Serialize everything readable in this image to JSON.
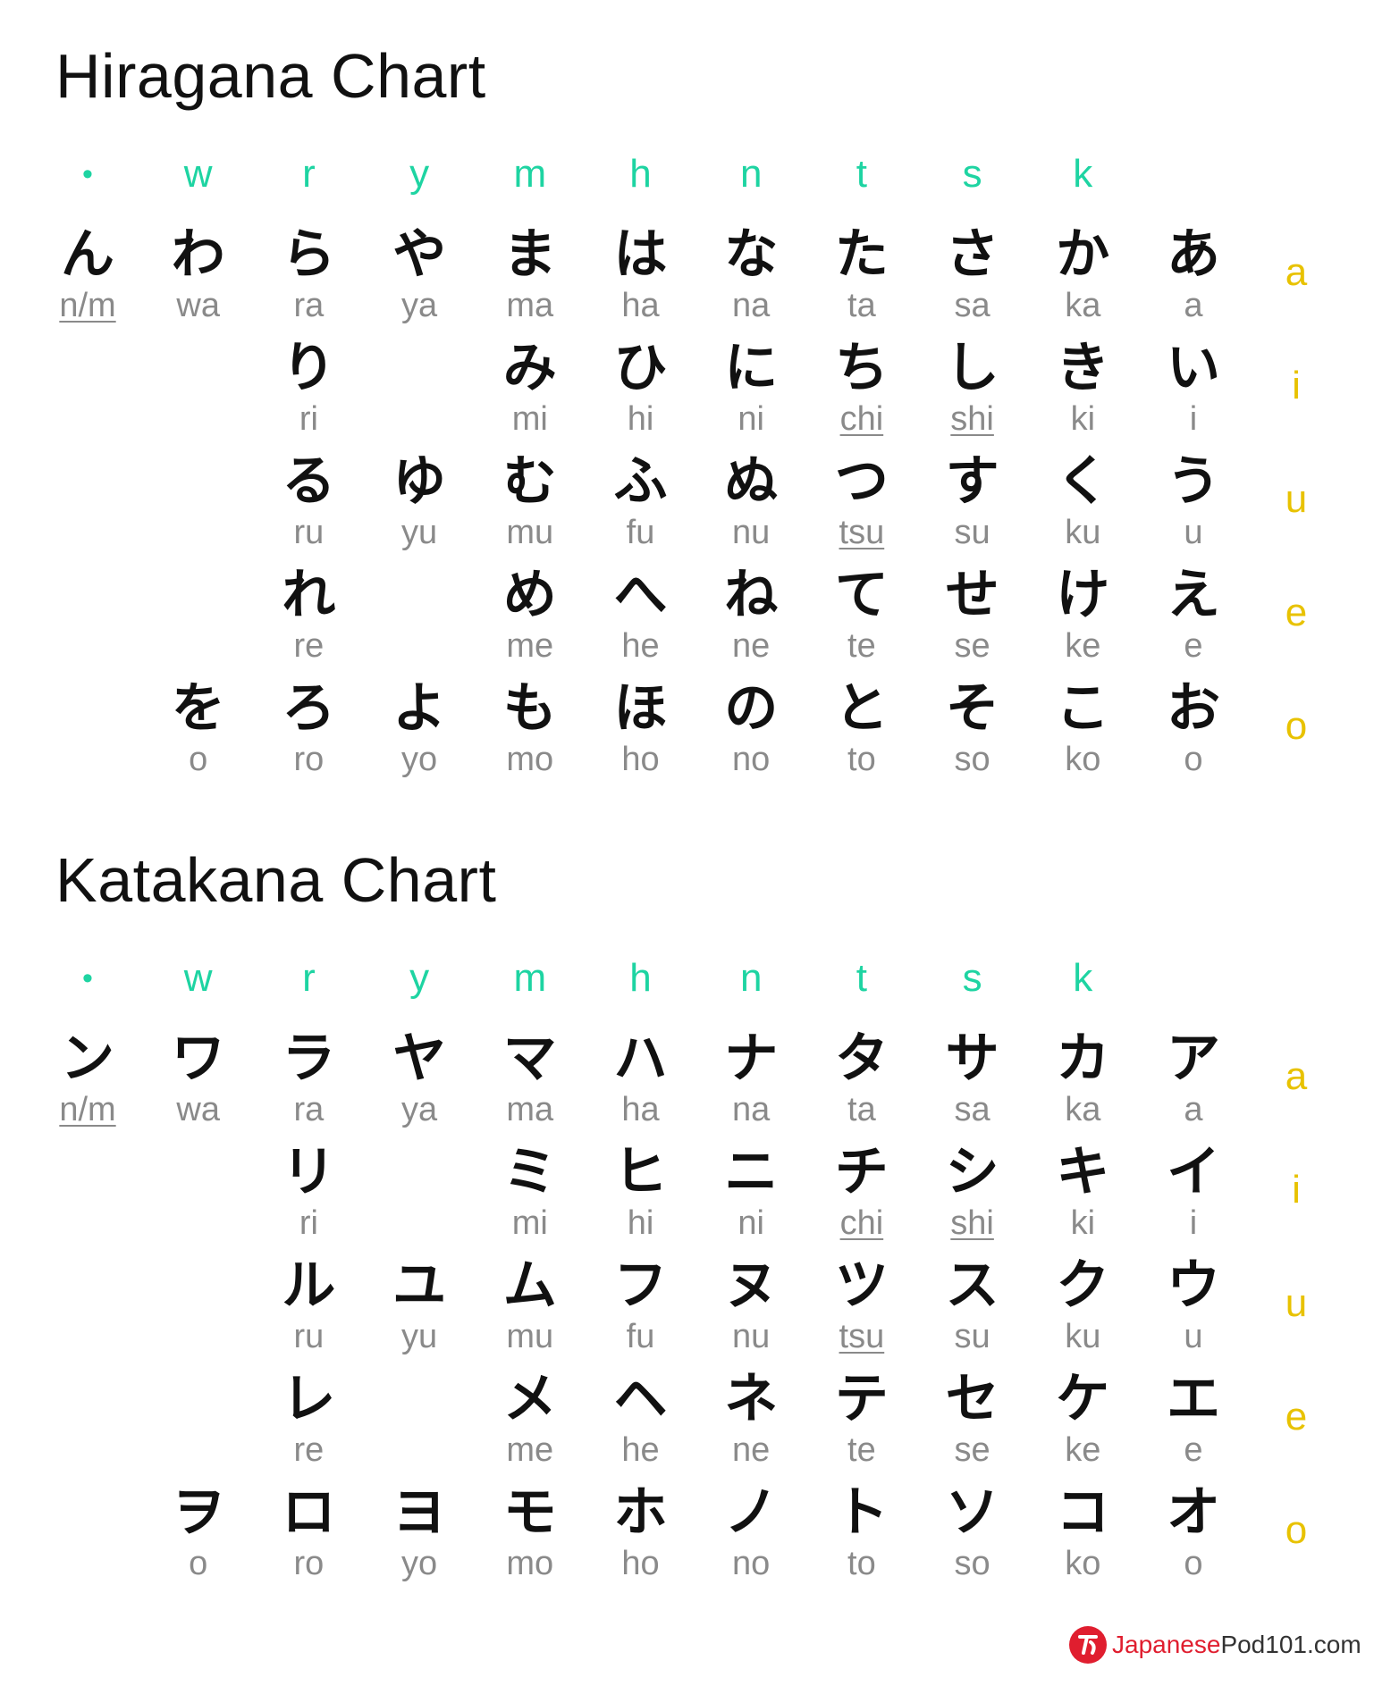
{
  "consonants": [
    "•",
    "w",
    "r",
    "y",
    "m",
    "h",
    "n",
    "t",
    "s",
    "k"
  ],
  "vowels": [
    "a",
    "i",
    "u",
    "e",
    "o"
  ],
  "hiragana": {
    "title": "Hiragana Chart",
    "cells": [
      {
        "col": 0,
        "row": 0,
        "kana": "ん",
        "romaji": "n/m",
        "underline": true
      },
      {
        "col": 1,
        "row": 0,
        "kana": "わ",
        "romaji": "wa"
      },
      {
        "col": 2,
        "row": 0,
        "kana": "ら",
        "romaji": "ra"
      },
      {
        "col": 3,
        "row": 0,
        "kana": "や",
        "romaji": "ya"
      },
      {
        "col": 4,
        "row": 0,
        "kana": "ま",
        "romaji": "ma"
      },
      {
        "col": 5,
        "row": 0,
        "kana": "は",
        "romaji": "ha"
      },
      {
        "col": 6,
        "row": 0,
        "kana": "な",
        "romaji": "na"
      },
      {
        "col": 7,
        "row": 0,
        "kana": "た",
        "romaji": "ta"
      },
      {
        "col": 8,
        "row": 0,
        "kana": "さ",
        "romaji": "sa"
      },
      {
        "col": 9,
        "row": 0,
        "kana": "か",
        "romaji": "ka"
      },
      {
        "col": 10,
        "row": 0,
        "kana": "あ",
        "romaji": "a"
      },
      {
        "col": 2,
        "row": 1,
        "kana": "り",
        "romaji": "ri"
      },
      {
        "col": 4,
        "row": 1,
        "kana": "み",
        "romaji": "mi"
      },
      {
        "col": 5,
        "row": 1,
        "kana": "ひ",
        "romaji": "hi"
      },
      {
        "col": 6,
        "row": 1,
        "kana": "に",
        "romaji": "ni"
      },
      {
        "col": 7,
        "row": 1,
        "kana": "ち",
        "romaji": "chi",
        "underline": true
      },
      {
        "col": 8,
        "row": 1,
        "kana": "し",
        "romaji": "shi",
        "underline": true
      },
      {
        "col": 9,
        "row": 1,
        "kana": "き",
        "romaji": "ki"
      },
      {
        "col": 10,
        "row": 1,
        "kana": "い",
        "romaji": "i"
      },
      {
        "col": 2,
        "row": 2,
        "kana": "る",
        "romaji": "ru"
      },
      {
        "col": 3,
        "row": 2,
        "kana": "ゆ",
        "romaji": "yu"
      },
      {
        "col": 4,
        "row": 2,
        "kana": "む",
        "romaji": "mu"
      },
      {
        "col": 5,
        "row": 2,
        "kana": "ふ",
        "romaji": "fu"
      },
      {
        "col": 6,
        "row": 2,
        "kana": "ぬ",
        "romaji": "nu"
      },
      {
        "col": 7,
        "row": 2,
        "kana": "つ",
        "romaji": "tsu",
        "underline": true
      },
      {
        "col": 8,
        "row": 2,
        "kana": "す",
        "romaji": "su"
      },
      {
        "col": 9,
        "row": 2,
        "kana": "く",
        "romaji": "ku"
      },
      {
        "col": 10,
        "row": 2,
        "kana": "う",
        "romaji": "u"
      },
      {
        "col": 2,
        "row": 3,
        "kana": "れ",
        "romaji": "re"
      },
      {
        "col": 4,
        "row": 3,
        "kana": "め",
        "romaji": "me"
      },
      {
        "col": 5,
        "row": 3,
        "kana": "へ",
        "romaji": "he"
      },
      {
        "col": 6,
        "row": 3,
        "kana": "ね",
        "romaji": "ne"
      },
      {
        "col": 7,
        "row": 3,
        "kana": "て",
        "romaji": "te"
      },
      {
        "col": 8,
        "row": 3,
        "kana": "せ",
        "romaji": "se"
      },
      {
        "col": 9,
        "row": 3,
        "kana": "け",
        "romaji": "ke"
      },
      {
        "col": 10,
        "row": 3,
        "kana": "え",
        "romaji": "e"
      },
      {
        "col": 1,
        "row": 4,
        "kana": "を",
        "romaji": "o"
      },
      {
        "col": 2,
        "row": 4,
        "kana": "ろ",
        "romaji": "ro"
      },
      {
        "col": 3,
        "row": 4,
        "kana": "よ",
        "romaji": "yo"
      },
      {
        "col": 4,
        "row": 4,
        "kana": "も",
        "romaji": "mo"
      },
      {
        "col": 5,
        "row": 4,
        "kana": "ほ",
        "romaji": "ho"
      },
      {
        "col": 6,
        "row": 4,
        "kana": "の",
        "romaji": "no"
      },
      {
        "col": 7,
        "row": 4,
        "kana": "と",
        "romaji": "to"
      },
      {
        "col": 8,
        "row": 4,
        "kana": "そ",
        "romaji": "so"
      },
      {
        "col": 9,
        "row": 4,
        "kana": "こ",
        "romaji": "ko"
      },
      {
        "col": 10,
        "row": 4,
        "kana": "お",
        "romaji": "o"
      }
    ]
  },
  "katakana": {
    "title": "Katakana Chart",
    "cells": [
      {
        "col": 0,
        "row": 0,
        "kana": "ン",
        "romaji": "n/m",
        "underline": true
      },
      {
        "col": 1,
        "row": 0,
        "kana": "ワ",
        "romaji": "wa"
      },
      {
        "col": 2,
        "row": 0,
        "kana": "ラ",
        "romaji": "ra"
      },
      {
        "col": 3,
        "row": 0,
        "kana": "ヤ",
        "romaji": "ya"
      },
      {
        "col": 4,
        "row": 0,
        "kana": "マ",
        "romaji": "ma"
      },
      {
        "col": 5,
        "row": 0,
        "kana": "ハ",
        "romaji": "ha"
      },
      {
        "col": 6,
        "row": 0,
        "kana": "ナ",
        "romaji": "na"
      },
      {
        "col": 7,
        "row": 0,
        "kana": "タ",
        "romaji": "ta"
      },
      {
        "col": 8,
        "row": 0,
        "kana": "サ",
        "romaji": "sa"
      },
      {
        "col": 9,
        "row": 0,
        "kana": "カ",
        "romaji": "ka"
      },
      {
        "col": 10,
        "row": 0,
        "kana": "ア",
        "romaji": "a"
      },
      {
        "col": 2,
        "row": 1,
        "kana": "リ",
        "romaji": "ri"
      },
      {
        "col": 4,
        "row": 1,
        "kana": "ミ",
        "romaji": "mi"
      },
      {
        "col": 5,
        "row": 1,
        "kana": "ヒ",
        "romaji": "hi"
      },
      {
        "col": 6,
        "row": 1,
        "kana": "ニ",
        "romaji": "ni"
      },
      {
        "col": 7,
        "row": 1,
        "kana": "チ",
        "romaji": "chi",
        "underline": true
      },
      {
        "col": 8,
        "row": 1,
        "kana": "シ",
        "romaji": "shi",
        "underline": true
      },
      {
        "col": 9,
        "row": 1,
        "kana": "キ",
        "romaji": "ki"
      },
      {
        "col": 10,
        "row": 1,
        "kana": "イ",
        "romaji": "i"
      },
      {
        "col": 2,
        "row": 2,
        "kana": "ル",
        "romaji": "ru"
      },
      {
        "col": 3,
        "row": 2,
        "kana": "ユ",
        "romaji": "yu"
      },
      {
        "col": 4,
        "row": 2,
        "kana": "ム",
        "romaji": "mu"
      },
      {
        "col": 5,
        "row": 2,
        "kana": "フ",
        "romaji": "fu"
      },
      {
        "col": 6,
        "row": 2,
        "kana": "ヌ",
        "romaji": "nu"
      },
      {
        "col": 7,
        "row": 2,
        "kana": "ツ",
        "romaji": "tsu",
        "underline": true
      },
      {
        "col": 8,
        "row": 2,
        "kana": "ス",
        "romaji": "su"
      },
      {
        "col": 9,
        "row": 2,
        "kana": "ク",
        "romaji": "ku"
      },
      {
        "col": 10,
        "row": 2,
        "kana": "ウ",
        "romaji": "u"
      },
      {
        "col": 2,
        "row": 3,
        "kana": "レ",
        "romaji": "re"
      },
      {
        "col": 4,
        "row": 3,
        "kana": "メ",
        "romaji": "me"
      },
      {
        "col": 5,
        "row": 3,
        "kana": "ヘ",
        "romaji": "he"
      },
      {
        "col": 6,
        "row": 3,
        "kana": "ネ",
        "romaji": "ne"
      },
      {
        "col": 7,
        "row": 3,
        "kana": "テ",
        "romaji": "te"
      },
      {
        "col": 8,
        "row": 3,
        "kana": "セ",
        "romaji": "se"
      },
      {
        "col": 9,
        "row": 3,
        "kana": "ケ",
        "romaji": "ke"
      },
      {
        "col": 10,
        "row": 3,
        "kana": "エ",
        "romaji": "e"
      },
      {
        "col": 1,
        "row": 4,
        "kana": "ヲ",
        "romaji": "o"
      },
      {
        "col": 2,
        "row": 4,
        "kana": "ロ",
        "romaji": "ro"
      },
      {
        "col": 3,
        "row": 4,
        "kana": "ヨ",
        "romaji": "yo"
      },
      {
        "col": 4,
        "row": 4,
        "kana": "モ",
        "romaji": "mo"
      },
      {
        "col": 5,
        "row": 4,
        "kana": "ホ",
        "romaji": "ho"
      },
      {
        "col": 6,
        "row": 4,
        "kana": "ノ",
        "romaji": "no"
      },
      {
        "col": 7,
        "row": 4,
        "kana": "ト",
        "romaji": "to"
      },
      {
        "col": 8,
        "row": 4,
        "kana": "ソ",
        "romaji": "so"
      },
      {
        "col": 9,
        "row": 4,
        "kana": "コ",
        "romaji": "ko"
      },
      {
        "col": 10,
        "row": 4,
        "kana": "オ",
        "romaji": "o"
      }
    ]
  },
  "logo": {
    "brand": "Japanese",
    "pod": "Pod101",
    "domain": ".com"
  },
  "colors": {
    "consonant": "#1ed4a2",
    "vowel": "#e8c200",
    "kana": "#111111",
    "romaji": "#8a8a8a",
    "brand_red": "#e01e2f"
  }
}
